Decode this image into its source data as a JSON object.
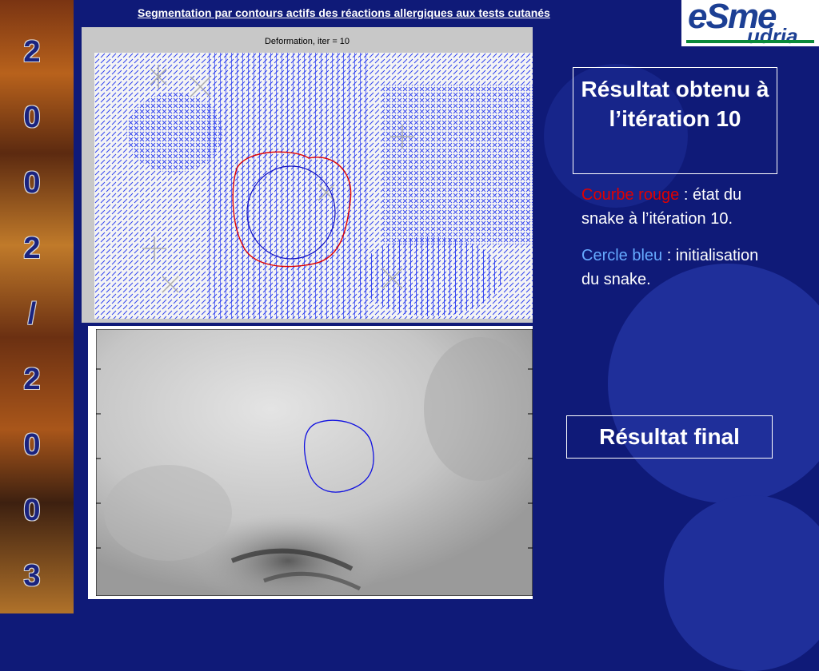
{
  "slide": {
    "title": "Segmentation par contours actifs des réactions allergiques aux tests cutanés",
    "year_chars": [
      "2",
      "0",
      "0",
      "2",
      "/",
      "2",
      "0",
      "0",
      "3"
    ]
  },
  "logo": {
    "main": "eSme",
    "sub": "udria",
    "color": "#1c3f94"
  },
  "figure_top": {
    "title": "Deformation,  iter = 10"
  },
  "panel": {
    "box_iter": "Résultat obtenu à l’itération 10",
    "red_label": "Courbe rouge",
    "red_sep": " :  ",
    "red_text_1": "état du",
    "red_text_2": "snake à l’itération 10.",
    "blue_label": "Cercle bleu",
    "blue_text_1": " : initialisation",
    "blue_text_2": "du snake.",
    "box_final": "Résultat final"
  },
  "colors": {
    "background": "#0f1a78",
    "red_curve": "#e00000",
    "blue_curve": "#2020ff"
  }
}
